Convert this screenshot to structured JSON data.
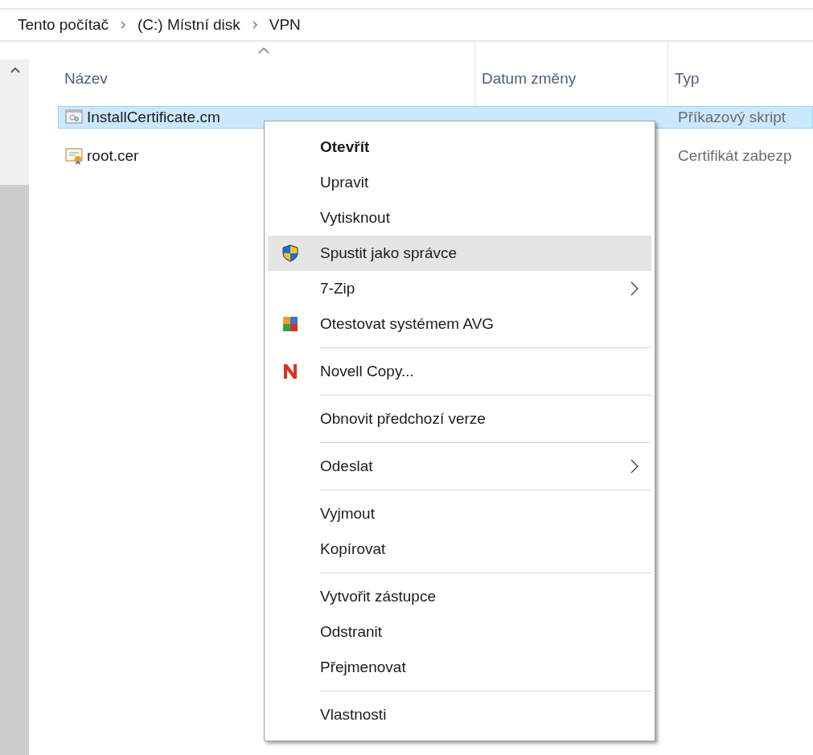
{
  "breadcrumb": [
    "Tento počítač",
    "(C:) Místní disk",
    "VPN"
  ],
  "columns": [
    {
      "label": "Název",
      "sorted": true
    },
    {
      "label": "Datum změny",
      "sorted": false
    },
    {
      "label": "Typ",
      "sorted": false
    }
  ],
  "files": [
    {
      "name": "InstallCertificate.cm",
      "type": "Příkazový skript",
      "kind": "script",
      "selected": true
    },
    {
      "name": "root.cer",
      "type": "Certifikát zabezp",
      "kind": "certificate",
      "selected": false
    }
  ],
  "context_menu": [
    {
      "kind": "item",
      "label": "Otevřít",
      "default": true,
      "selected": false
    },
    {
      "kind": "item",
      "label": "Upravit",
      "default": false,
      "selected": false
    },
    {
      "kind": "item",
      "label": "Vytisknout",
      "default": false,
      "selected": false
    },
    {
      "kind": "shield",
      "label": "Spustit jako správce",
      "default": false,
      "selected": true
    },
    {
      "kind": "item",
      "label": "7-Zip",
      "submenu": true,
      "default": false,
      "selected": false
    },
    {
      "kind": "squares",
      "label": "Otestovat systémem AVG",
      "default": false,
      "selected": false
    },
    {
      "kind": "separator"
    },
    {
      "kind": "letter",
      "label": "Novell Copy...",
      "default": false,
      "selected": false
    },
    {
      "kind": "separator"
    },
    {
      "kind": "item",
      "label": "Obnovit předchozí verze",
      "default": false,
      "selected": false
    },
    {
      "kind": "separator"
    },
    {
      "kind": "item",
      "label": "Odeslat",
      "submenu": true,
      "default": false,
      "selected": false
    },
    {
      "kind": "separator"
    },
    {
      "kind": "item",
      "label": "Vyjmout",
      "default": false,
      "selected": false
    },
    {
      "kind": "item",
      "label": "Kopírovat",
      "default": false,
      "selected": false
    },
    {
      "kind": "separator"
    },
    {
      "kind": "item",
      "label": "Vytvořit zástupce",
      "default": false,
      "selected": false
    },
    {
      "kind": "item",
      "label": "Odstranit",
      "default": false,
      "selected": false
    },
    {
      "kind": "item",
      "label": "Přejmenovat",
      "default": false,
      "selected": false
    },
    {
      "kind": "separator"
    },
    {
      "kind": "item",
      "label": "Vlastnosti",
      "default": false,
      "selected": false
    }
  ]
}
